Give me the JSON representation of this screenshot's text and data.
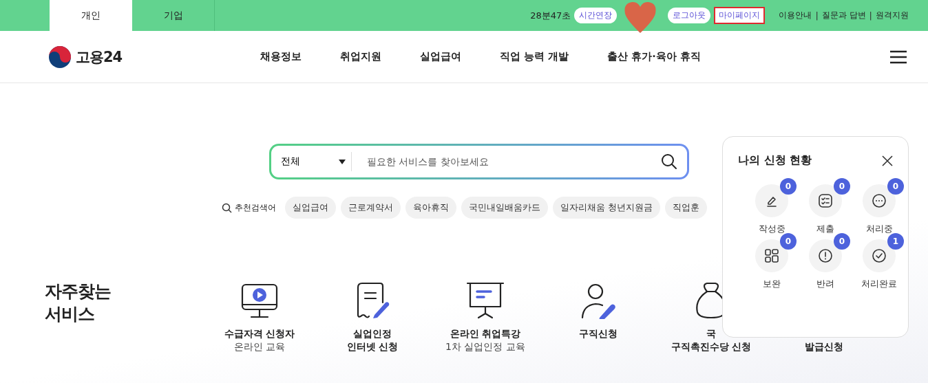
{
  "top_bar": {
    "tabs": [
      {
        "label": "개인",
        "selected": true
      },
      {
        "label": "기업",
        "selected": false
      }
    ],
    "timer": "28분47초",
    "extend_button": "시간연장",
    "logout_button": "로그아웃",
    "mypage_button": {
      "label": "마이페이지",
      "highlighted": true
    },
    "links": [
      "이용안내",
      "질문과 답변",
      "원격지원"
    ],
    "link_separator": "|"
  },
  "header": {
    "logo": "고용24",
    "nav": [
      "채용정보",
      "취업지원",
      "실업급여",
      "직업 능력 개발",
      "출산 휴가·육아 휴직"
    ]
  },
  "search": {
    "scope": "전체",
    "placeholder": "필요한 서비스를 찾아보세요"
  },
  "recommended": {
    "label": "추천검색어",
    "chips": [
      "실업급여",
      "근로계약서",
      "육아휴직",
      "국민내일배움카드",
      "일자리채움 청년지원금",
      "직업훈"
    ]
  },
  "services": {
    "title": "자주찾는 서비스",
    "items": [
      {
        "kind": "monitor",
        "lines": [
          {
            "text": "수급자격 신청자",
            "kind": "title"
          },
          {
            "text": "온라인 교육",
            "kind": "sub"
          }
        ]
      },
      {
        "kind": "document",
        "lines": [
          {
            "text": "실업인정",
            "kind": "title"
          },
          {
            "text": "인터넷 신청",
            "kind": "title"
          }
        ]
      },
      {
        "kind": "board",
        "lines": [
          {
            "text": "온라인 취업특강",
            "kind": "title"
          },
          {
            "text": "1차 실업인정 교육",
            "kind": "sub"
          }
        ]
      },
      {
        "kind": "person",
        "lines": [
          {
            "text": "구직신청",
            "kind": "title"
          }
        ]
      },
      {
        "kind": "bag",
        "lines": [
          {
            "text": "국",
            "kind": "title"
          },
          {
            "text": "구직촉진수당 신청",
            "kind": "title"
          }
        ]
      },
      {
        "kind": "hidden",
        "lines": [
          {
            "text": "발급신청",
            "kind": "title"
          }
        ]
      }
    ]
  },
  "status_panel": {
    "title": "나의 신청 현황",
    "items": [
      {
        "label": "작성중",
        "count": "0",
        "kind": "pencil"
      },
      {
        "label": "제출",
        "count": "0",
        "kind": "checklist"
      },
      {
        "label": "처리중",
        "count": "0",
        "kind": "dots"
      },
      {
        "label": "보완",
        "count": "0",
        "kind": "blocks"
      },
      {
        "label": "반려",
        "count": "0",
        "kind": "alert"
      },
      {
        "label": "처리완료",
        "count": "1",
        "kind": "check"
      }
    ]
  }
}
